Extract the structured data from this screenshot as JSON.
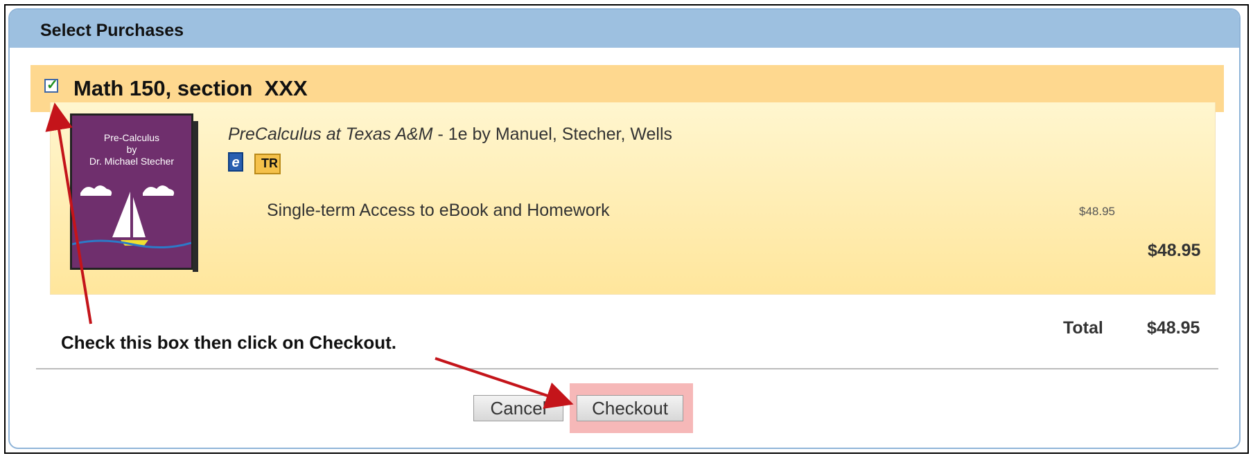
{
  "panel": {
    "title": "Select Purchases"
  },
  "course": {
    "title": "Math 150, section  XXX",
    "checked": true
  },
  "book": {
    "cover_lines": [
      "Pre-Calculus",
      "by",
      "Dr. Michael Stecher"
    ],
    "title_italic": "PreCalculus at Texas A&M",
    "title_rest": " - 1e by Manuel, Stecher, Wells",
    "icons": {
      "ebook": "e",
      "tr": "TR"
    }
  },
  "item": {
    "label": "Single-term Access to eBook and Homework",
    "price": "$48.95",
    "subtotal": "$48.95"
  },
  "totals": {
    "label": "Total",
    "value": "$48.95"
  },
  "instruction": "Check this box then click on Checkout.",
  "buttons": {
    "cancel": "Cancel",
    "checkout": "Checkout"
  },
  "colors": {
    "header": "#9dc0e0",
    "course_bar": "#fed88f",
    "highlight": "#f6b8b8",
    "arrow": "#c4141a"
  }
}
